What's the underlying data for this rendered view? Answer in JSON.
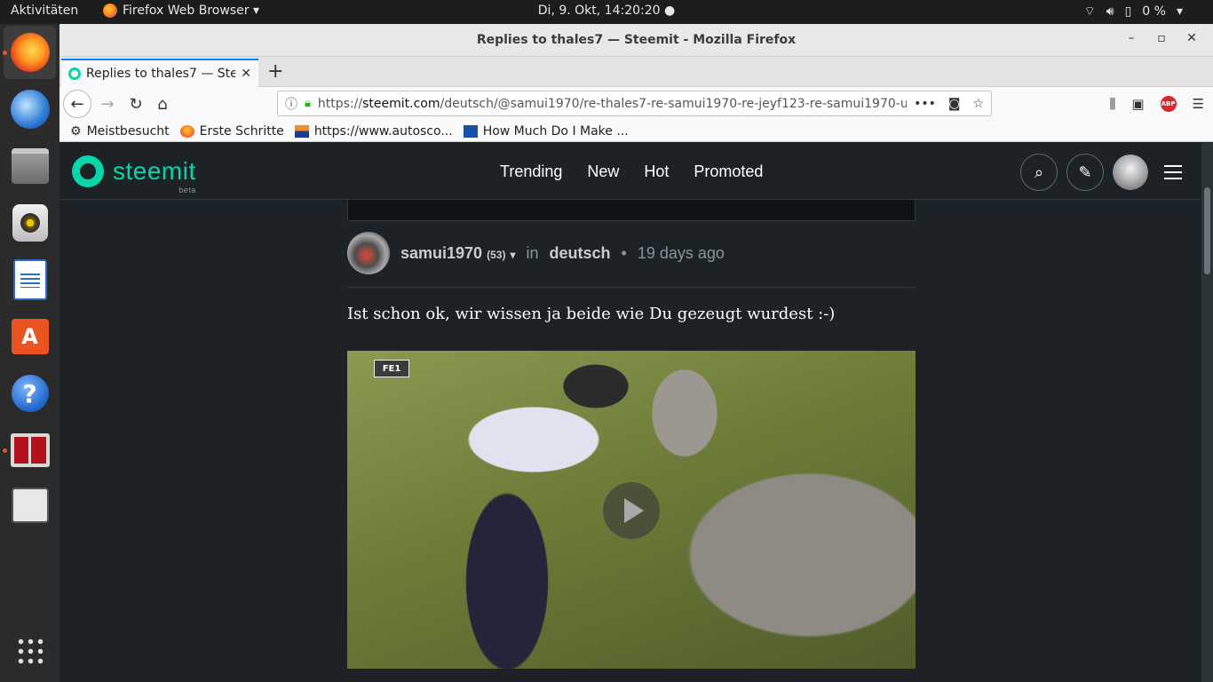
{
  "top_panel": {
    "activities": "Aktivitäten",
    "app_name": "Firefox Web Browser ▾",
    "clock": "Di,  9. Okt, 14:20:20 ●",
    "battery": "0 %"
  },
  "window": {
    "title": "Replies to thales7 — Steemit - Mozilla Firefox"
  },
  "tab": {
    "title": "Replies to thales7 — Steemit"
  },
  "url": {
    "prefix": "https://",
    "domain": "steemit.com",
    "path": "/deutsch/@samui1970/re-thales7-re-samui1970-re-jeyf123-re-samui1970-u"
  },
  "bookmarks": [
    {
      "label": "Meistbesucht"
    },
    {
      "label": "Erste Schritte"
    },
    {
      "label": "https://www.autosco..."
    },
    {
      "label": "How Much Do I Make ..."
    }
  ],
  "site": {
    "logo": "steemit",
    "beta": "beta",
    "nav": [
      "Trending",
      "New",
      "Hot",
      "Promoted"
    ]
  },
  "post": {
    "author": "samui1970",
    "reputation": "(53)",
    "in_label": "in",
    "category": "deutsch",
    "time": "19 days ago",
    "body": "Ist schon ok, wir wissen ja beide wie Du gezeugt wurdest :-)",
    "tv_logo": "FE1"
  },
  "icons": {
    "wifi": "wifi-icon",
    "volume": "volume-icon",
    "battery": "battery-icon"
  },
  "colors": {
    "steemit_accent": "#06d6a9",
    "page_bg": "#1c2226",
    "tab_active": "#0a84ff"
  }
}
